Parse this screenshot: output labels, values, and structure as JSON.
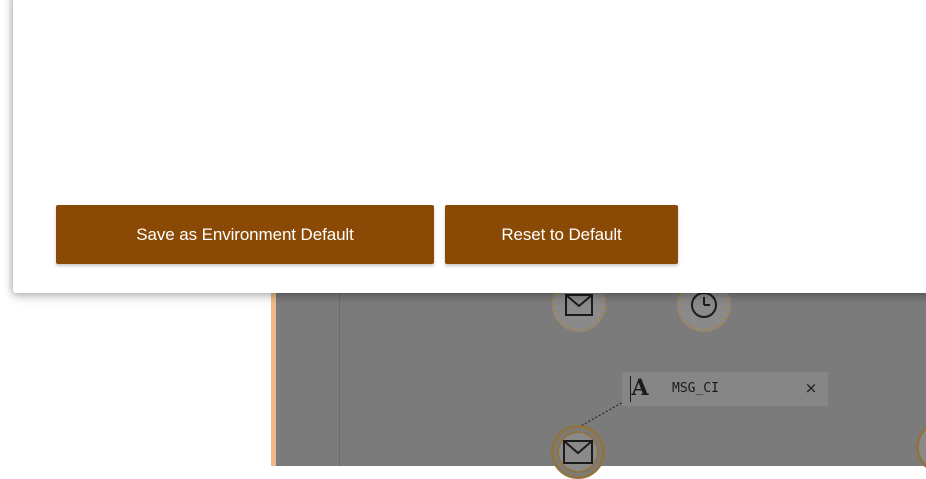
{
  "panel": {
    "buttons": {
      "save_label": "Save as Environment Default",
      "reset_label": "Reset to Default"
    },
    "button_color": "#8a4a06"
  },
  "canvas": {
    "background_color": "#7b7b7b",
    "accent_border_color": "#f0b988",
    "nodes": [
      {
        "name": "message-event",
        "icon": "envelope-icon"
      },
      {
        "name": "timer-event",
        "icon": "clock-icon"
      },
      {
        "name": "message-event",
        "icon": "envelope-icon"
      }
    ],
    "annotation": {
      "icon": "text-annotation-icon",
      "icon_glyph": "A",
      "label": "MSG_CI",
      "close_glyph": "×"
    }
  }
}
